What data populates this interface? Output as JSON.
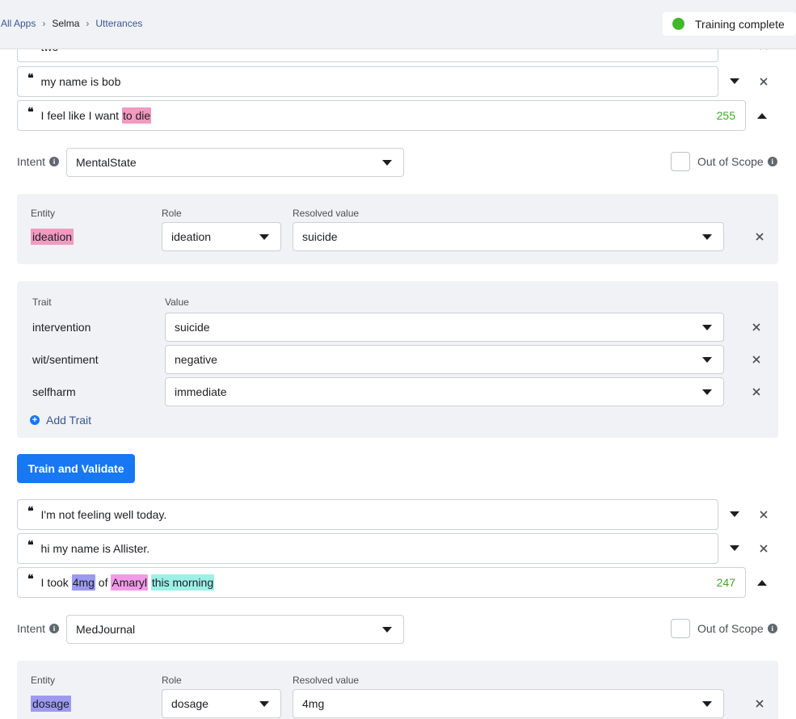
{
  "breadcrumb": {
    "items": [
      "All Apps",
      "Selma",
      "Utterances"
    ]
  },
  "status": {
    "label": "Training complete",
    "color": "#42b72a"
  },
  "utterances_top": [
    {
      "text": "two",
      "partial": true
    },
    {
      "text": "my name is bob"
    }
  ],
  "utterance1": {
    "segments": [
      {
        "text": "I feel like I want ",
        "hl": ""
      },
      {
        "text": "to die",
        "hl": "#f29ac0"
      }
    ],
    "count": "255",
    "intent_label": "Intent",
    "intent_value": "MentalState",
    "out_of_scope_label": "Out of Scope",
    "entity": {
      "col_entity": "Entity",
      "col_role": "Role",
      "col_resolved": "Resolved value",
      "name": "ideation",
      "color": "#f29ac0",
      "role": "ideation",
      "resolved": "suicide"
    },
    "traits": {
      "col_trait": "Trait",
      "col_value": "Value",
      "rows": [
        {
          "name": "intervention",
          "value": "suicide"
        },
        {
          "name": "wit/sentiment",
          "value": "negative"
        },
        {
          "name": "selfharm",
          "value": "immediate"
        }
      ],
      "add_label": "Add Trait"
    },
    "train_button": "Train and Validate"
  },
  "utterances_mid": [
    {
      "text": "I'm not feeling well today."
    },
    {
      "text": "hi my name is Allister."
    }
  ],
  "utterance2": {
    "segments": [
      {
        "text": "I took ",
        "hl": ""
      },
      {
        "text": "4mg",
        "hl": "#9c9af0"
      },
      {
        "text": " of ",
        "hl": ""
      },
      {
        "text": "Amaryl",
        "hl": "#f29ae8"
      },
      {
        "text": " ",
        "hl": ""
      },
      {
        "text": "this morning",
        "hl": "#9cf0e6"
      }
    ],
    "count": "247",
    "intent_label": "Intent",
    "intent_value": "MedJournal",
    "out_of_scope_label": "Out of Scope",
    "entity": {
      "col_entity": "Entity",
      "col_role": "Role",
      "col_resolved": "Resolved value",
      "name": "dosage",
      "color": "#9c9af0",
      "role": "dosage",
      "resolved": "4mg"
    }
  }
}
